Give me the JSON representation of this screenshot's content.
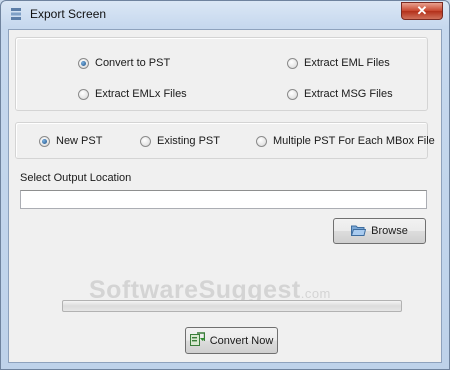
{
  "window": {
    "title": "Export Screen",
    "close_glyph": "✕"
  },
  "export_options": [
    {
      "label": "Convert to PST",
      "checked": true
    },
    {
      "label": "Extract EML Files",
      "checked": false
    },
    {
      "label": "Extract EMLx Files",
      "checked": false
    },
    {
      "label": "Extract MSG Files",
      "checked": false
    }
  ],
  "pst_options": [
    {
      "label": "New PST",
      "checked": true
    },
    {
      "label": "Existing PST",
      "checked": false
    },
    {
      "label": "Multiple PST For Each MBox File",
      "checked": false
    }
  ],
  "output": {
    "label": "Select Output Location",
    "value": "",
    "browse_label": "Browse"
  },
  "progress": {
    "value": 0
  },
  "watermark": {
    "main": "SoftwareSuggest",
    "suffix": ".com"
  },
  "convert_label": "Convert Now",
  "icons": {
    "app": "app-icon",
    "folder": "folder-icon",
    "convert": "convert-icon"
  }
}
